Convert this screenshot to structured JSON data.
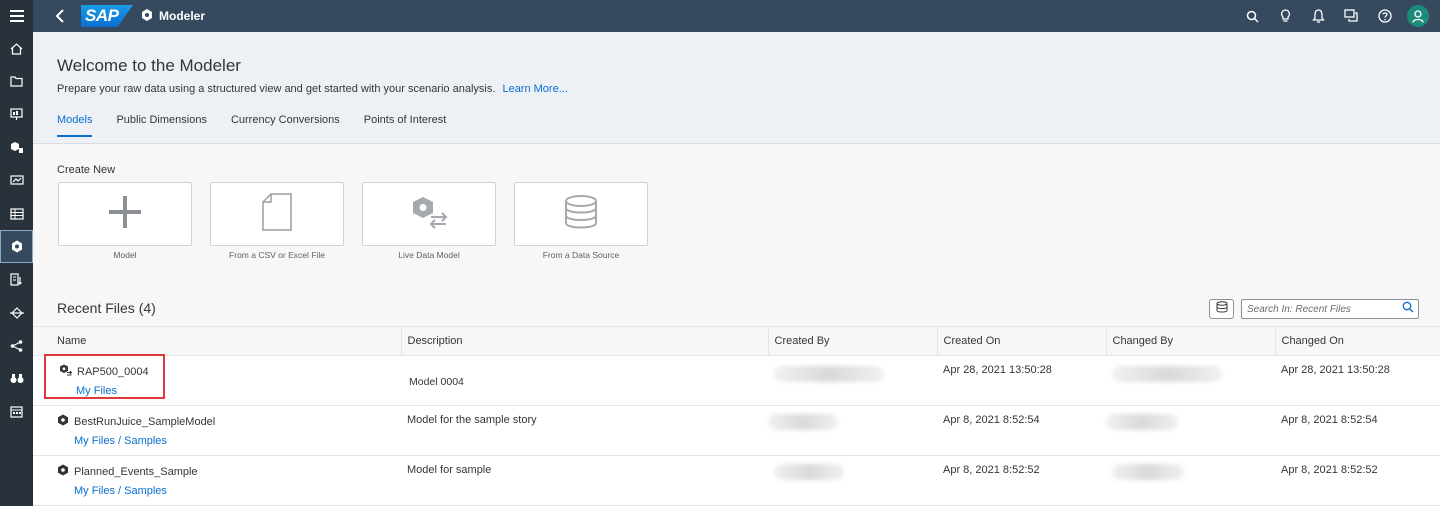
{
  "shell": {
    "logo_text": "SAP",
    "app_title": "Modeler",
    "actions": [
      "search-icon",
      "lightbulb-icon",
      "bell-icon",
      "chat-icon",
      "help-icon",
      "user-avatar-icon"
    ]
  },
  "nav": {
    "items": [
      "home-icon",
      "folder-icon",
      "stories-icon",
      "analytic-apps-icon",
      "digital-boardroom-icon",
      "datasets-icon",
      "modeler-icon",
      "data-analyzer-icon",
      "data-integration-icon",
      "connections-icon",
      "explore-icon",
      "calendar-icon"
    ],
    "active_index": 6
  },
  "header": {
    "title": "Welcome to the Modeler",
    "subtitle": "Prepare your raw data using a structured view and get started with your scenario analysis.",
    "learn_more": "Learn More...",
    "tabs": [
      {
        "label": "Models",
        "selected": true
      },
      {
        "label": "Public Dimensions",
        "selected": false
      },
      {
        "label": "Currency Conversions",
        "selected": false
      },
      {
        "label": "Points of Interest",
        "selected": false
      }
    ]
  },
  "create_new": {
    "label": "Create New",
    "tiles": [
      {
        "label": "Model",
        "icon": "plus-icon"
      },
      {
        "label": "From a CSV or Excel File",
        "icon": "file-icon"
      },
      {
        "label": "Live Data Model",
        "icon": "live-data-icon"
      },
      {
        "label": "From a Data Source",
        "icon": "database-icon"
      }
    ]
  },
  "recent": {
    "title": "Recent Files (4)",
    "search_placeholder": "Search In: Recent Files",
    "columns": [
      "Name",
      "Description",
      "Created By",
      "Created On",
      "Changed By",
      "Changed On"
    ],
    "rows": [
      {
        "name": "RAP500_0004",
        "path1": "My Files",
        "path2": "",
        "description": "Model 0004",
        "created_on": "Apr 28, 2021 13:50:28",
        "changed_on": "Apr 28, 2021 13:50:28",
        "icon": "live-model-icon"
      },
      {
        "name": "BestRunJuice_SampleModel",
        "path1": "My Files",
        "path2": "Samples",
        "description": "Model for the sample story",
        "created_on": "Apr 8, 2021 8:52:54",
        "changed_on": "Apr 8, 2021 8:52:54",
        "icon": "model-icon"
      },
      {
        "name": "Planned_Events_Sample",
        "path1": "My Files",
        "path2": "Samples",
        "description": "Model for sample",
        "created_on": "Apr 8, 2021 8:52:52",
        "changed_on": "Apr 8, 2021 8:52:52",
        "icon": "model-icon"
      }
    ]
  },
  "colors": {
    "shell": "#354a5f",
    "nav": "#29313a",
    "link": "#0a6ed1",
    "highlight": "#e0383d"
  }
}
